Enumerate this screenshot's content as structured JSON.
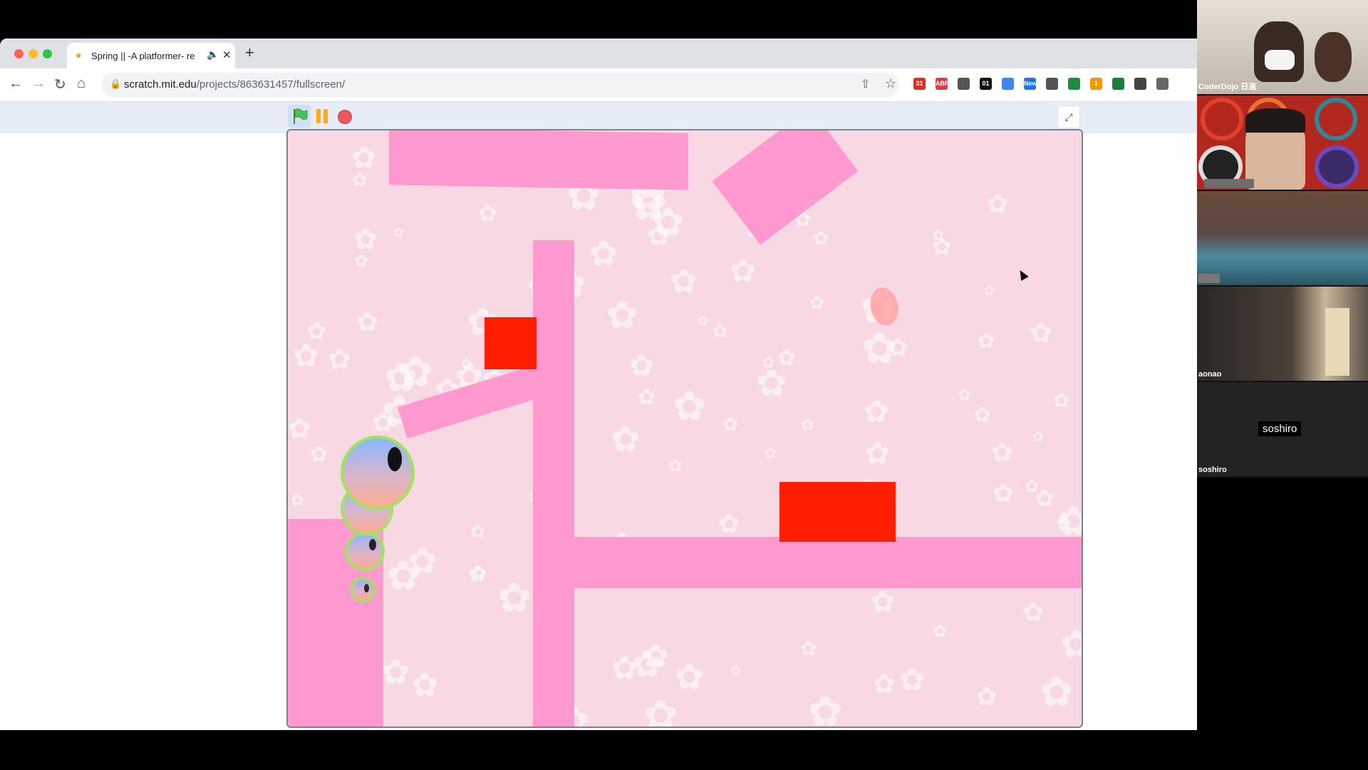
{
  "browser": {
    "tab": {
      "title": "Spring || -A platformer- re",
      "favicon": "scratch-cat-icon"
    },
    "url": {
      "host": "scratch.mit.edu",
      "path": "/projects/863631457/fullscreen/"
    },
    "extensions": [
      {
        "name": "gmail-icon",
        "label": "31",
        "color": "#d93025"
      },
      {
        "name": "adblock-icon",
        "label": "ABP",
        "color": "#e0393e"
      },
      {
        "name": "clock-icon",
        "label": "",
        "color": "#555555"
      },
      {
        "name": "toggl-icon",
        "label": "01",
        "color": "#111111"
      },
      {
        "name": "google-icon",
        "label": "",
        "color": "#4285f4"
      },
      {
        "name": "news-icon",
        "label": "New",
        "color": "#1a73e8"
      },
      {
        "name": "puzzle-icon",
        "label": "",
        "color": "#555555"
      },
      {
        "name": "diamond-icon",
        "label": "",
        "color": "#1e8e3e"
      },
      {
        "name": "orange-extension-icon",
        "label": "1",
        "color": "#f29900"
      },
      {
        "name": "green-square-icon",
        "label": "",
        "color": "#188038"
      },
      {
        "name": "qr-icon",
        "label": "",
        "color": "#444444"
      },
      {
        "name": "grid-icon",
        "label": "",
        "color": "#666666"
      }
    ]
  },
  "scratch": {
    "controls": {
      "flag": "green-flag-icon",
      "pause": "pause-icon",
      "stop": "stop-icon",
      "fullscreen_exit": "exit-fullscreen-icon"
    },
    "colors": {
      "platform": "#ff99cf",
      "block": "#ff1f00",
      "background": "#f8d8e3"
    }
  },
  "video": {
    "participants": [
      {
        "name": "CoderDojo 日進"
      },
      {
        "name": ""
      },
      {
        "name": ""
      },
      {
        "name": "aonao"
      },
      {
        "name": "soshiro",
        "badge": "soshiro"
      }
    ]
  }
}
